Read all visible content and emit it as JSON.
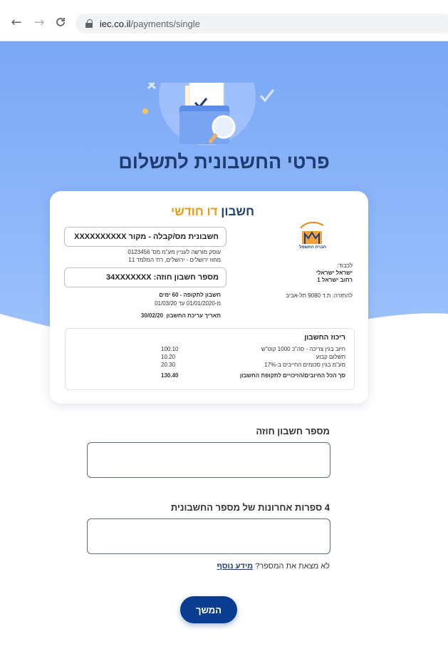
{
  "browser": {
    "url_domain": "iec.co.il",
    "url_path": "/payments/single"
  },
  "page": {
    "title": "פרטי החשבונית לתשלום"
  },
  "bill": {
    "title_main": "חשבון",
    "title_accent": "דו חודשי",
    "logo_caption": "חברת החשמל",
    "invoice_source": "חשבונית מס/קבלה - מקור XXXXXXXXXX",
    "dealer_line": "עוסק מורשה לעניין מע\"מ מס' 0123456",
    "district_line": "מחוז ירושלים - ירושלים, רח' המלמד 11",
    "contract_box": "מספר חשבון חוזה: 34XXXXXXX",
    "period_line": "חשבון לתקופה - 60 ימים",
    "dates_line": "מ-01/01/2020 עד 01/03/20",
    "issue_label": "תאריך עריכת החשבון",
    "issue_date": "30/02/20",
    "to_label": "לכבוד:",
    "recipient_name": "ישראל ישראלי",
    "recipient_street": "רחוב ישראל 1",
    "return_address": "להחזרה: ת.ד 9080 תל-אביב",
    "summary": {
      "title": "ריכוז החשבון",
      "rows": [
        {
          "label": "חיוב בגין צריכה - סה\"כ 1000 קוט\"ש",
          "amount": "100.10"
        },
        {
          "label": "תשלום קבוע",
          "amount": "10.20"
        },
        {
          "label": "מע\"מ בגין סכומים החייבים ב-17%",
          "amount": "20.30"
        }
      ],
      "total_label": "סך הכל החיובים/הזיכויים לתקופת החשבון",
      "total_amount": "130.40"
    }
  },
  "form": {
    "contract_label": "מספר חשבון חוזה",
    "contract_value": "",
    "digits_label": "4 ספרות אחרונות של מספר החשבונית",
    "digits_value": "",
    "help_text": "לא מצאת את המספר?",
    "help_link": "מידע נוסף",
    "continue_label": "המשך"
  },
  "colors": {
    "brand_blue": "#0a3d8f",
    "title_blue": "#1f3b6f",
    "accent_orange": "#e89a10",
    "band_blue": "#7aa7f5"
  }
}
